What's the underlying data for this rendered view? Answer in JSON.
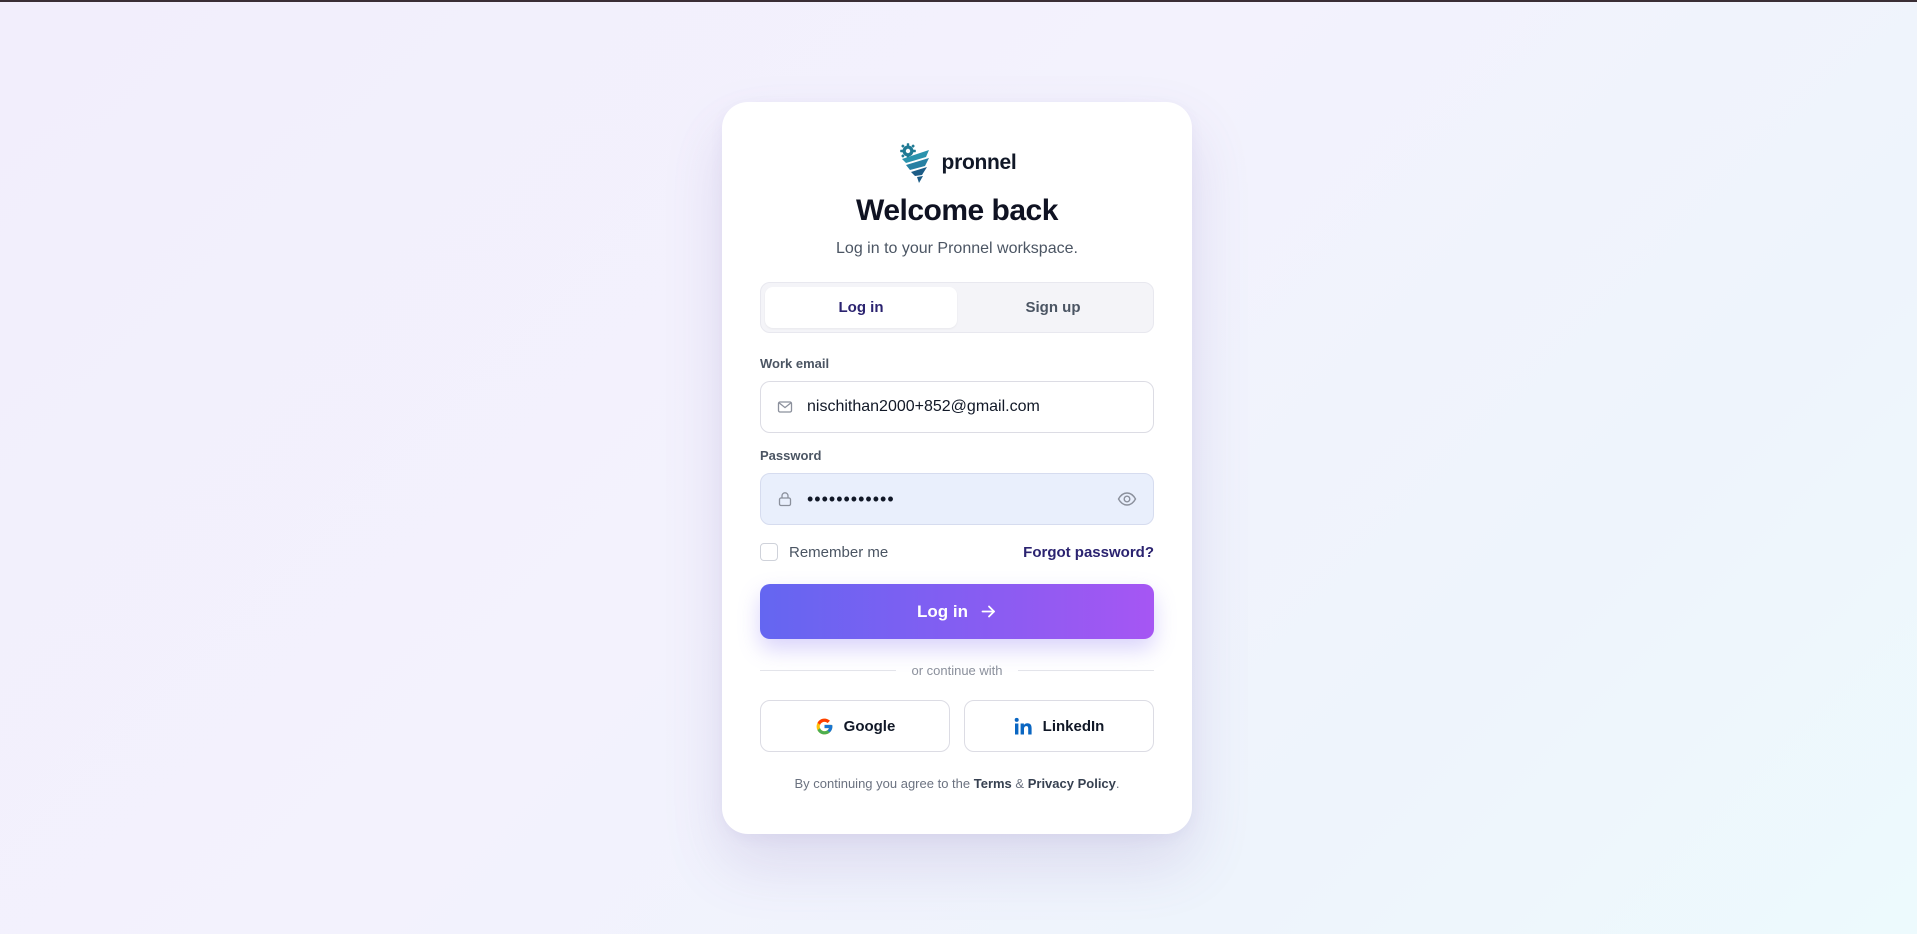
{
  "brand": {
    "name": "pronnel",
    "logo_icon": "pronnel-logo-icon",
    "logo_colors": [
      "#1f7a94",
      "#2a93ad",
      "#1c5c86"
    ]
  },
  "header": {
    "title": "Welcome back",
    "subtitle": "Log in to your Pronnel workspace."
  },
  "tabs": [
    {
      "label": "Log in",
      "active": true
    },
    {
      "label": "Sign up",
      "active": false
    }
  ],
  "form": {
    "email": {
      "label": "Work email",
      "value": "nischithan2000+852@gmail.com",
      "icon": "mail-icon"
    },
    "password": {
      "label": "Password",
      "value": "••••••••••••",
      "icon": "lock-icon",
      "toggle_icon": "eye-icon"
    },
    "remember": {
      "label": "Remember me",
      "checked": false
    },
    "forgot_label": "Forgot password?",
    "submit_label": "Log in",
    "submit_icon": "arrow-right-icon"
  },
  "divider_text": "or continue with",
  "social": [
    {
      "label": "Google",
      "icon": "google-icon"
    },
    {
      "label": "LinkedIn",
      "icon": "linkedin-icon"
    }
  ],
  "terms": {
    "prefix": "By continuing you agree to the",
    "terms_label": "Terms",
    "separator": "&",
    "privacy_label": "Privacy Policy",
    "suffix": "."
  },
  "colors": {
    "accent_start": "#6466f1",
    "accent_end": "#a656f3",
    "link": "#2b2370",
    "filled_field_bg": "#e9effc"
  }
}
